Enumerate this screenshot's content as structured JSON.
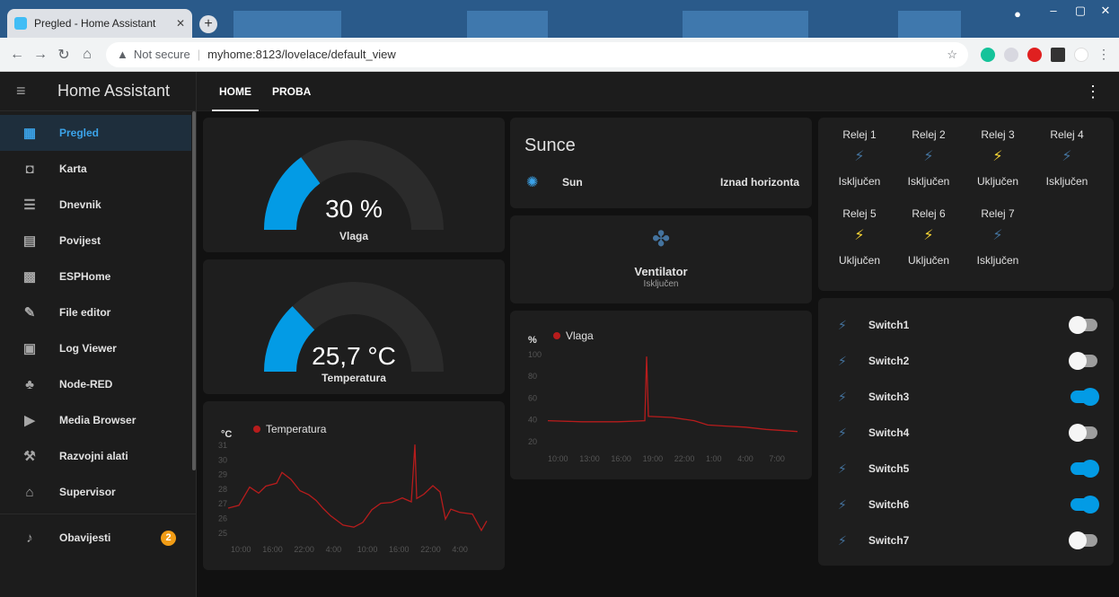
{
  "browser": {
    "tab_title": "Pregled - Home Assistant",
    "url_warning": "Not secure",
    "url": "myhome:8123/lovelace/default_view"
  },
  "sidebar": {
    "title": "Home Assistant",
    "items": [
      {
        "label": "Pregled",
        "icon": "dashboard-icon"
      },
      {
        "label": "Karta",
        "icon": "map-icon"
      },
      {
        "label": "Dnevnik",
        "icon": "logbook-icon"
      },
      {
        "label": "Povijest",
        "icon": "history-icon"
      },
      {
        "label": "ESPHome",
        "icon": "chip-icon"
      },
      {
        "label": "File editor",
        "icon": "wrench-icon"
      },
      {
        "label": "Log Viewer",
        "icon": "log-icon"
      },
      {
        "label": "Node-RED",
        "icon": "sitemap-icon"
      },
      {
        "label": "Media Browser",
        "icon": "media-icon"
      },
      {
        "label": "Razvojni alati",
        "icon": "hammer-icon"
      },
      {
        "label": "Supervisor",
        "icon": "supervisor-icon"
      }
    ],
    "notifications": {
      "label": "Obavijesti",
      "count": "2"
    }
  },
  "header": {
    "tabs": [
      "HOME",
      "PROBA"
    ]
  },
  "gauges": [
    {
      "value": "30 %",
      "label": "Vlaga",
      "fraction": 0.3,
      "color": "#039be5"
    },
    {
      "value": "25,7 °C",
      "label": "Temperatura",
      "fraction": 0.26,
      "color": "#039be5"
    }
  ],
  "sun": {
    "title": "Sunce",
    "entity": "Sun",
    "state": "Iznad horizonta"
  },
  "fan": {
    "name": "Ventilator",
    "state": "Isključen"
  },
  "temp_chart": {
    "unit": "°C",
    "legend": "Temperatura",
    "yticks": [
      "31",
      "30",
      "29",
      "28",
      "27",
      "26",
      "25"
    ],
    "xticks": [
      "10:00",
      "16:00",
      "22:00",
      "4:00",
      "10:00",
      "16:00",
      "22:00",
      "4:00"
    ]
  },
  "hum_chart": {
    "unit": "%",
    "legend": "Vlaga",
    "yticks": [
      "100",
      "80",
      "60",
      "40",
      "20"
    ],
    "xticks": [
      "10:00",
      "13:00",
      "16:00",
      "19:00",
      "22:00",
      "1:00",
      "4:00",
      "7:00"
    ]
  },
  "relays": [
    {
      "name": "Relej 1",
      "state": "Isključen",
      "on": false
    },
    {
      "name": "Relej 2",
      "state": "Isključen",
      "on": false
    },
    {
      "name": "Relej 3",
      "state": "Uključen",
      "on": true
    },
    {
      "name": "Relej 4",
      "state": "Isključen",
      "on": false
    },
    {
      "name": "Relej 5",
      "state": "Uključen",
      "on": true
    },
    {
      "name": "Relej 6",
      "state": "Uključen",
      "on": true
    },
    {
      "name": "Relej 7",
      "state": "Isključen",
      "on": false
    }
  ],
  "switches": [
    {
      "name": "Switch1",
      "on": false
    },
    {
      "name": "Switch2",
      "on": false
    },
    {
      "name": "Switch3",
      "on": true
    },
    {
      "name": "Switch4",
      "on": false
    },
    {
      "name": "Switch5",
      "on": true
    },
    {
      "name": "Switch6",
      "on": true
    },
    {
      "name": "Switch7",
      "on": false
    }
  ],
  "colors": {
    "accent": "#039be5",
    "relay_on": "#fdd835",
    "relay_off": "#44739e",
    "line": "#b71c1c"
  }
}
